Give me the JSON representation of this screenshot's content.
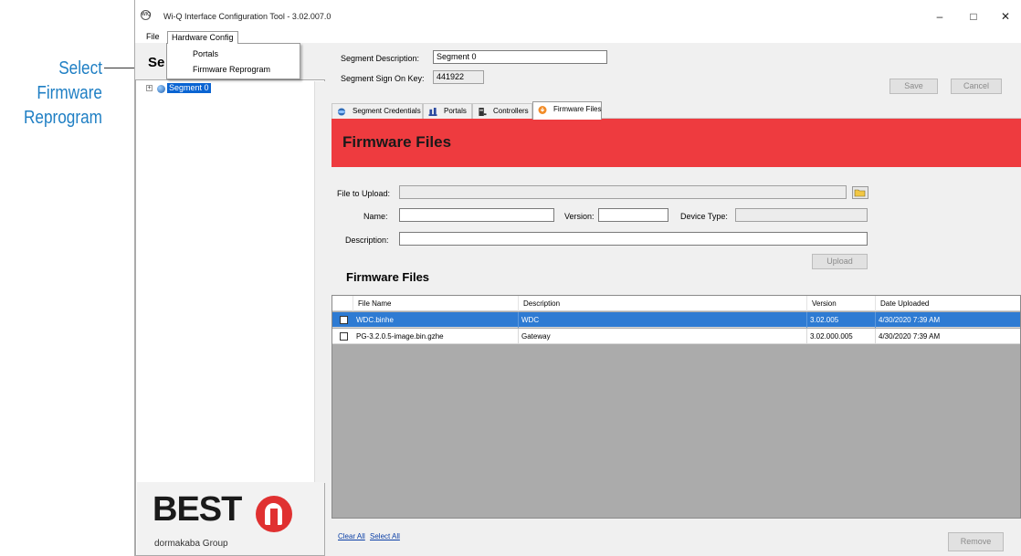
{
  "annotation": {
    "lines": [
      "Select",
      "Firmware",
      "Reprogram"
    ]
  },
  "window": {
    "title": "Wi-Q Interface Configuration Tool - 3.02.007.0",
    "app_icon_text": "WIQ",
    "minimize": "–",
    "maximize": "□",
    "close": "✕"
  },
  "menubar": {
    "file": "File",
    "hardware_config": "Hardware Config"
  },
  "dropdown": {
    "items": [
      "Portals",
      "Firmware Reprogram"
    ]
  },
  "left_panel": {
    "heading": "Se",
    "tree": {
      "expander": "+",
      "node_label": "Segment 0"
    },
    "logo": {
      "text": "BEST",
      "subtext": "dormakaba Group"
    }
  },
  "segment": {
    "description_label": "Segment Description:",
    "description_value": "Segment 0",
    "signon_label": "Segment Sign On Key:",
    "signon_value": "441922"
  },
  "actions": {
    "save": "Save",
    "cancel": "Cancel"
  },
  "tabs": [
    {
      "label": "Segment Credentials",
      "icon": "globe-icon"
    },
    {
      "label": "Portals",
      "icon": "portals-icon"
    },
    {
      "label": "Controllers",
      "icon": "controller-icon"
    },
    {
      "label": "Firmware Files",
      "icon": "firmware-icon",
      "active": true
    }
  ],
  "banner": {
    "title": "Firmware Files",
    "color": "#ee3b3f"
  },
  "form": {
    "file_label": "File to Upload:",
    "file_value": "",
    "name_label": "Name:",
    "name_value": "",
    "version_label": "Version:",
    "version_value": "",
    "device_type_label": "Device Type:",
    "device_type_value": "",
    "description_label": "Description:",
    "description_value": "",
    "upload": "Upload"
  },
  "files_section": {
    "title": "Firmware Files",
    "columns": [
      "File Name",
      "Description",
      "Version",
      "Date Uploaded"
    ],
    "rows": [
      {
        "file": "WDC.binhe",
        "description": "WDC",
        "version": "3.02.005",
        "date": "4/30/2020 7:39 AM",
        "selected": true
      },
      {
        "file": "PG-3.2.0.5-image.bin.gzhe",
        "description": "Gateway",
        "version": "3.02.000.005",
        "date": "4/30/2020 7:39 AM",
        "selected": false
      }
    ]
  },
  "footer": {
    "clear_all": "Clear All",
    "select_all": "Select All",
    "remove": "Remove"
  },
  "colors": {
    "accent": "#1f7fc4",
    "selection": "#2e7bd3",
    "banner_red": "#ee3b3f"
  }
}
